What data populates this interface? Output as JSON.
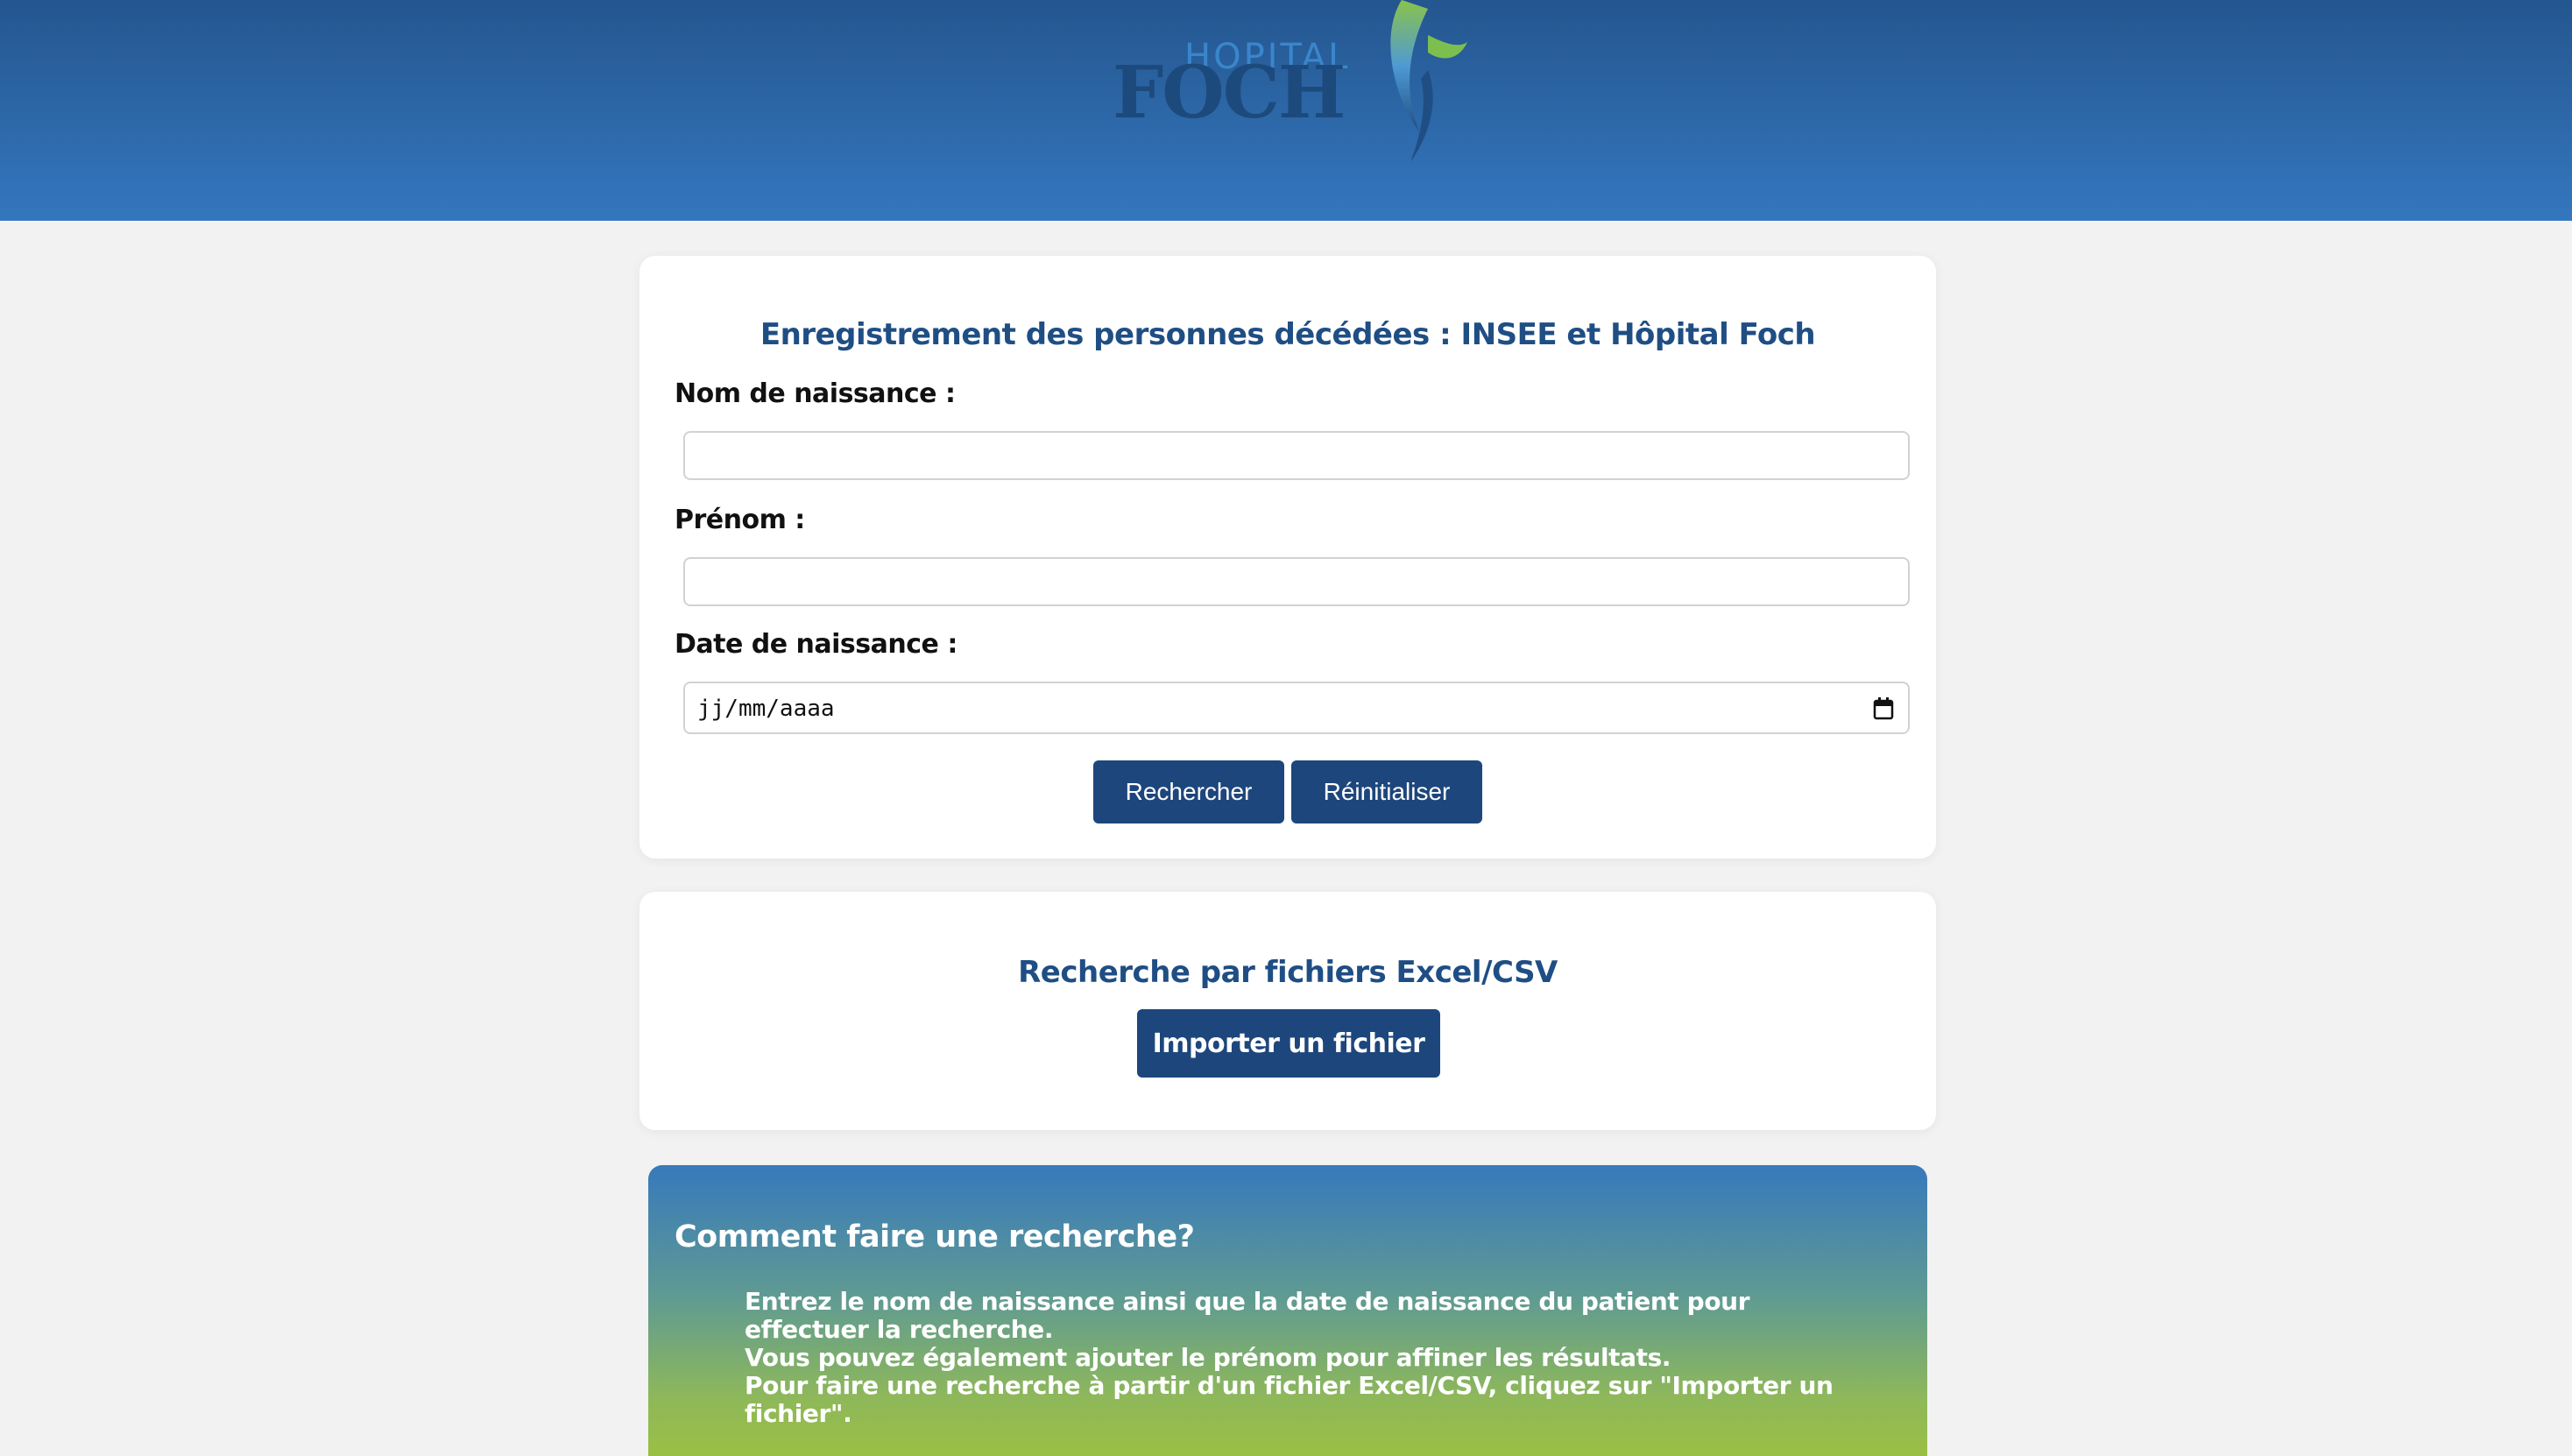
{
  "header": {
    "logo": {
      "top_text": "HOPITAL",
      "main_text": "FOCH"
    }
  },
  "search_form": {
    "title": "Enregistrement des personnes décédées : INSEE et Hôpital Foch",
    "birth_name_label": "Nom de naissance :",
    "birth_name_value": "",
    "first_name_label": "Prénom :",
    "first_name_value": "",
    "birth_date_label": "Date de naissance :",
    "birth_date_placeholder": "jj/mm/aaaa",
    "search_button": "Rechercher",
    "reset_button": "Réinitialiser"
  },
  "file_search": {
    "title": "Recherche par fichiers Excel/CSV",
    "import_button": "Importer un fichier"
  },
  "help": {
    "title": "Comment faire une recherche?",
    "lines": [
      "Entrez le nom de naissance ainsi que la date de naissance du patient pour effectuer la recherche.",
      "Vous pouvez également ajouter le prénom pour affiner les résultats.",
      "Pour faire une recherche à partir d'un fichier Excel/CSV, cliquez sur \"Importer un fichier\"."
    ]
  },
  "colors": {
    "header_top": "#24568f",
    "header_bottom": "#3477be",
    "accent": "#1d467c",
    "title_text": "#1f4e84"
  }
}
